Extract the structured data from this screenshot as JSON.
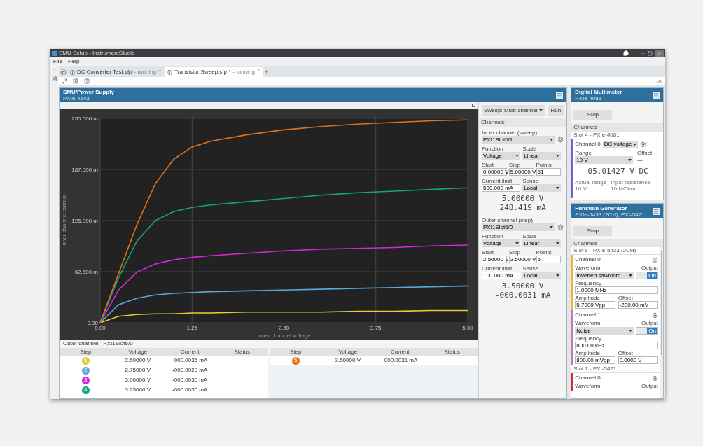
{
  "window": {
    "title": "SMU Setup - InstrumentStudio"
  },
  "menu": [
    "File",
    "Help"
  ],
  "tabs": [
    {
      "label": "DC Converter Test.sfp",
      "status": "- running",
      "selected": false
    },
    {
      "label": "Transistor Sweep.sfp *",
      "status": "- running",
      "selected": true
    }
  ],
  "smu": {
    "title": "SMU/Power Supply",
    "subtitle": "PXIe-4143",
    "chart_data": {
      "type": "line",
      "grid": true,
      "xlabel": "Inner channel voltage",
      "ylabel": "Inner channel current",
      "x": [
        0,
        0.25,
        0.5,
        0.75,
        1,
        1.25,
        1.5,
        2,
        2.5,
        3,
        3.5,
        4,
        4.5,
        5
      ],
      "xlim": [
        0,
        5
      ],
      "ylim": [
        0,
        250
      ],
      "xticks": [
        {
          "value": 0,
          "label": "0.00"
        },
        {
          "value": 1.25,
          "label": "1.25"
        },
        {
          "value": 2.5,
          "label": "2.50"
        },
        {
          "value": 3.75,
          "label": "3.75"
        },
        {
          "value": 5,
          "label": "5.00"
        }
      ],
      "yticks": [
        {
          "value": 0,
          "label": "0.00"
        },
        {
          "value": 62.5,
          "label": "62.500 m"
        },
        {
          "value": 125,
          "label": "125.000 m"
        },
        {
          "value": 187.5,
          "label": "187.500 m"
        },
        {
          "value": 250,
          "label": "250.000 m"
        }
      ],
      "series": [
        {
          "color": "#e3cf3a",
          "values": [
            0,
            8,
            10,
            11,
            11,
            12,
            12,
            13,
            13,
            13,
            14,
            14,
            15,
            15
          ]
        },
        {
          "color": "#5aa7d8",
          "values": [
            0,
            22,
            30,
            34,
            36,
            37,
            38,
            39,
            40,
            41,
            42,
            43,
            44,
            45
          ]
        },
        {
          "color": "#d12ad6",
          "values": [
            0,
            40,
            62,
            72,
            77,
            80,
            82,
            85,
            88,
            90,
            91,
            92,
            94,
            95
          ]
        },
        {
          "color": "#16a37a",
          "values": [
            0,
            55,
            100,
            125,
            136,
            141,
            144,
            148,
            152,
            156,
            159,
            161,
            163,
            165
          ]
        },
        {
          "color": "#e0711b",
          "values": [
            0,
            60,
            120,
            170,
            200,
            215,
            222,
            230,
            236,
            240,
            243,
            245,
            247,
            248
          ]
        }
      ]
    },
    "table": {
      "title": "Outer channel - PXI1Slot6/0",
      "halves": [
        {
          "columns": [
            "Step",
            "Voltage",
            "Current",
            "Status"
          ],
          "rows": [
            {
              "step": "1",
              "color": "#e3cf3a",
              "voltage": "2.50000 V",
              "current": "-000.0035 mA"
            },
            {
              "step": "2",
              "color": "#5aa7d8",
              "voltage": "2.75000 V",
              "current": "-000.0029 mA"
            },
            {
              "step": "3",
              "color": "#d12ad6",
              "voltage": "3.00000 V",
              "current": "-000.0030 mA"
            },
            {
              "step": "4",
              "color": "#16a37a",
              "voltage": "3.25000 V",
              "current": "-000.0030 mA"
            }
          ]
        },
        {
          "columns": [
            "Step",
            "Voltage",
            "Current",
            "Status"
          ],
          "rows": [
            {
              "step": "5",
              "color": "#e0711b",
              "voltage": "3.50000 V",
              "current": "-000.0031 mA"
            }
          ]
        }
      ]
    }
  },
  "sweep": {
    "mode": "Sweep: Multi-channel",
    "run": "Run",
    "section": "Channels",
    "channels": [
      {
        "heading": "Inner channel (sweep)",
        "device": "PXI1Slot6/1",
        "rows": [
          [
            {
              "label": "Function",
              "value": "Voltage",
              "kind": "select"
            },
            {
              "label": "Scale",
              "value": "Linear",
              "kind": "select"
            }
          ],
          [
            {
              "label": "Start",
              "value": "0.00000 V",
              "kind": "input"
            },
            {
              "label": "Stop",
              "value": "5.00000 V",
              "kind": "input"
            },
            {
              "label": "Points",
              "value": "51",
              "kind": "input"
            }
          ],
          [
            {
              "label": "Current limit",
              "value": "500.000 mA",
              "kind": "input"
            },
            {
              "label": "Sense",
              "value": "Local",
              "kind": "select"
            }
          ]
        ],
        "voltage": "5.00000 V",
        "current": "248.419 mA"
      },
      {
        "heading": "Outer channel (step)",
        "device": "PXI1Slot6/0",
        "rows": [
          [
            {
              "label": "Function",
              "value": "Voltage",
              "kind": "select"
            },
            {
              "label": "Scale",
              "value": "Linear",
              "kind": "select"
            }
          ],
          [
            {
              "label": "Start",
              "value": "2.50000 V",
              "kind": "input"
            },
            {
              "label": "Stop",
              "value": "3.50000 V",
              "kind": "input"
            },
            {
              "label": "Points",
              "value": "5",
              "kind": "input"
            }
          ],
          [
            {
              "label": "Current limit",
              "value": "100.000 mA",
              "kind": "input"
            },
            {
              "label": "Sense",
              "value": "Local",
              "kind": "select"
            }
          ]
        ],
        "voltage": "3.50000 V",
        "current": "-000.0031 mA"
      }
    ]
  },
  "dmm": {
    "title": "Digital Multimeter",
    "subtitle": "PXIe-4081",
    "stop": "Stop",
    "section": "Channels",
    "slot": "Slot 4 - PXIe-4081",
    "channel": {
      "name": "Channel 0",
      "color": "#7b5fc7",
      "function": "DC voltage",
      "range_label": "Range",
      "range": "10 V",
      "offset_label": "Offset",
      "offset": "---",
      "reading": "05.01427 V DC",
      "info": [
        {
          "label": "Actual range",
          "value": "10 V"
        },
        {
          "label": "Input resistance",
          "value": "10 MOhm"
        }
      ]
    }
  },
  "fgen": {
    "title": "Function Generator",
    "subtitle": "PXIe-5433 (2CH), PXI-5421",
    "stop": "Stop",
    "section": "Channels",
    "slots": [
      {
        "slot": "Slot 6 - PXIe-5433 (2CH)",
        "channels": [
          {
            "name": "Channel 0",
            "color": "#e8b830",
            "waveform_label": "Waveform",
            "waveform": "Inverted sawtooth",
            "output_label": "Output",
            "output": "On",
            "on": true,
            "frequency_label": "Frequency",
            "frequency": "1.0000 MHz",
            "amplitude_label": "Amplitude",
            "amplitude": "5.7000 Vpp",
            "offset_label": "Offset",
            "offset": "-200.00 mV"
          },
          {
            "name": "Channel 1",
            "color": "#c07ab8",
            "waveform_label": "Waveform",
            "waveform": "Noise",
            "output_label": "Output",
            "output": "On",
            "on": true,
            "frequency_label": "Frequency",
            "frequency": "800.00 kHz",
            "amplitude_label": "Amplitude",
            "amplitude": "800.00 mVpp",
            "offset_label": "Offset",
            "offset": "0.0000 V"
          }
        ]
      },
      {
        "slot": "Slot 7 - PXI-5421",
        "channels": [
          {
            "name": "Channel 0",
            "color": "#d0283c",
            "waveform_label": "Waveform",
            "output_label": "Output"
          }
        ]
      }
    ]
  }
}
